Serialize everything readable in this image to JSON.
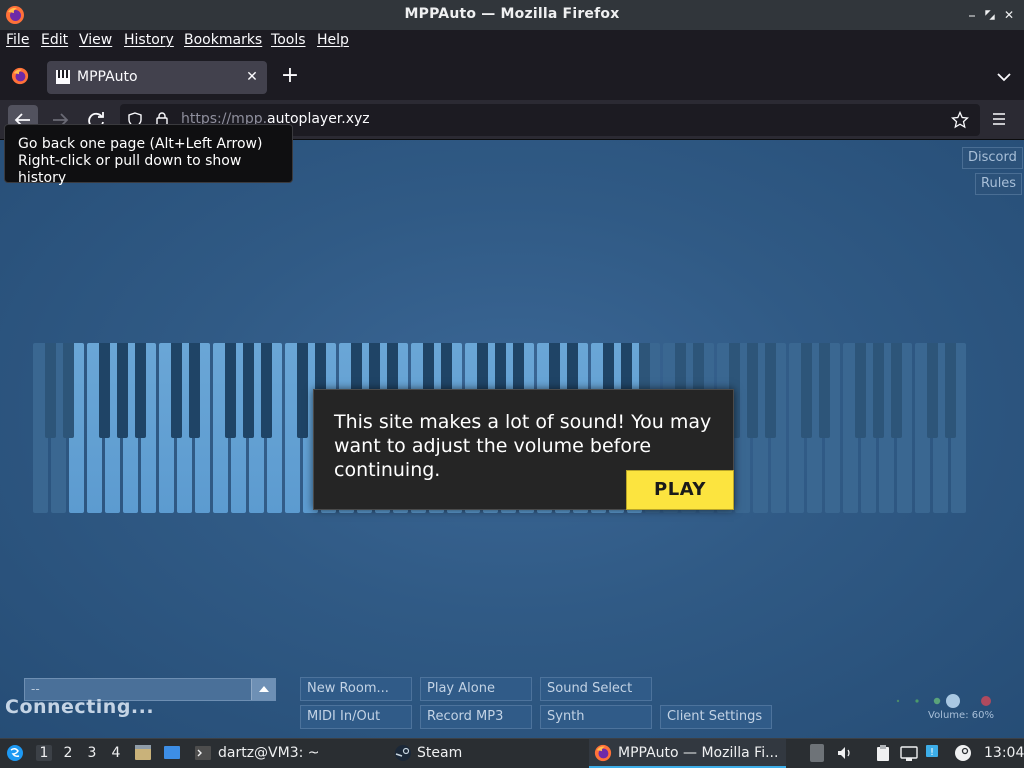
{
  "window": {
    "title": "MPPAuto — Mozilla Firefox"
  },
  "menubar": {
    "items": [
      "File",
      "Edit",
      "View",
      "History",
      "Bookmarks",
      "Tools",
      "Help"
    ]
  },
  "tab": {
    "label": "MPPAuto",
    "close_icon": "close-icon"
  },
  "nav": {
    "url_prefix": "https://mpp.",
    "url_domain": "autoplayer.xyz"
  },
  "tooltip": {
    "line1": "Go back one page (Alt+Left Arrow)",
    "line2": "Right-click or pull down to show history"
  },
  "page": {
    "discord": "Discord",
    "rules": "Rules",
    "modal_message": "This site makes a lot of sound! You may want to adjust the volume before continuing.",
    "play_label": "PLAY",
    "chat_value": "--",
    "status": "Connecting...",
    "controls_row1": [
      "New Room...",
      "Play Alone",
      "Sound Select"
    ],
    "controls_row2": [
      "MIDI In/Out",
      "Record MP3",
      "Synth",
      "Client Settings"
    ],
    "volume_label": "Volume: 60%",
    "volume_level": 0.6
  },
  "taskbar": {
    "workspaces": [
      "1",
      "2",
      "3",
      "4"
    ],
    "terminal": "dartz@VM3: ~",
    "steam": "Steam",
    "firefox": "MPPAuto — Mozilla Fi...",
    "clock": "13:04"
  },
  "colors": {
    "accent": "#3daee9",
    "play_button": "#fce43f",
    "page_bg": "#305a85"
  }
}
